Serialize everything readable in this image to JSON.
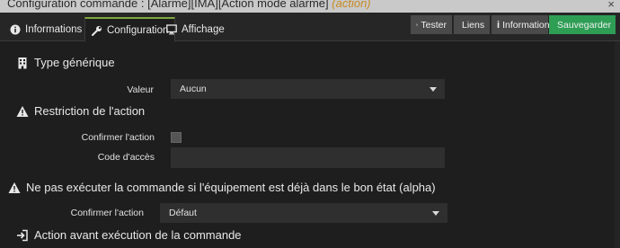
{
  "window": {
    "title": "Configuration commande : [Alarme][IMA][Action mode alarme]",
    "subtitle": "(action)"
  },
  "tabs": [
    {
      "label": "Informations",
      "icon": "info-circle-icon"
    },
    {
      "label": "Configuration",
      "icon": "wrench-icon"
    },
    {
      "label": "Affichage",
      "icon": "monitor-icon"
    }
  ],
  "toolbar": {
    "tester": "Tester",
    "liens": "Liens",
    "informations": "Informations",
    "sauvegarder": "Sauvegarder"
  },
  "sections": {
    "type_generique": {
      "title": "Type générique",
      "valeur_label": "Valeur",
      "valeur_value": "Aucun"
    },
    "restriction": {
      "title": "Restriction de l'action",
      "confirmer_label": "Confirmer l'action",
      "code_label": "Code d'accès",
      "code_value": ""
    },
    "ne_pas_executer": {
      "title": "Ne pas exécuter la commande si l'équipement est déjà dans le bon état (alpha)",
      "confirmer_label": "Confirmer l'action",
      "confirmer_value": "Défaut"
    },
    "action_avant": {
      "title": "Action avant exécution de la commande"
    }
  },
  "colors": {
    "accent": "#7fa83d",
    "save": "#2e9e55",
    "subtitle": "#c98a22"
  }
}
